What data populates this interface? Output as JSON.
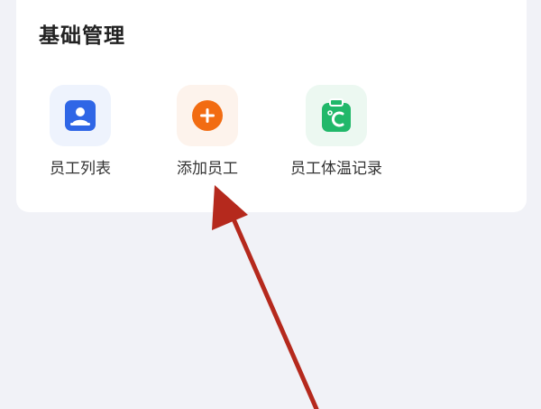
{
  "section": {
    "title": "基础管理"
  },
  "tiles": [
    {
      "label": "员工列表",
      "icon": "person-card-icon",
      "color": "#2f66e6",
      "halo": "#eef3fd"
    },
    {
      "label": "添加员工",
      "icon": "plus-circle-icon",
      "color": "#f26c12",
      "halo": "#fdf3ec"
    },
    {
      "label": "员工体温记录",
      "icon": "temperature-clipboard-icon",
      "color": "#21b86a",
      "halo": "#ecf8f1"
    }
  ],
  "annotation": {
    "icon": "red-arrow-icon",
    "color": "#b5291d"
  }
}
